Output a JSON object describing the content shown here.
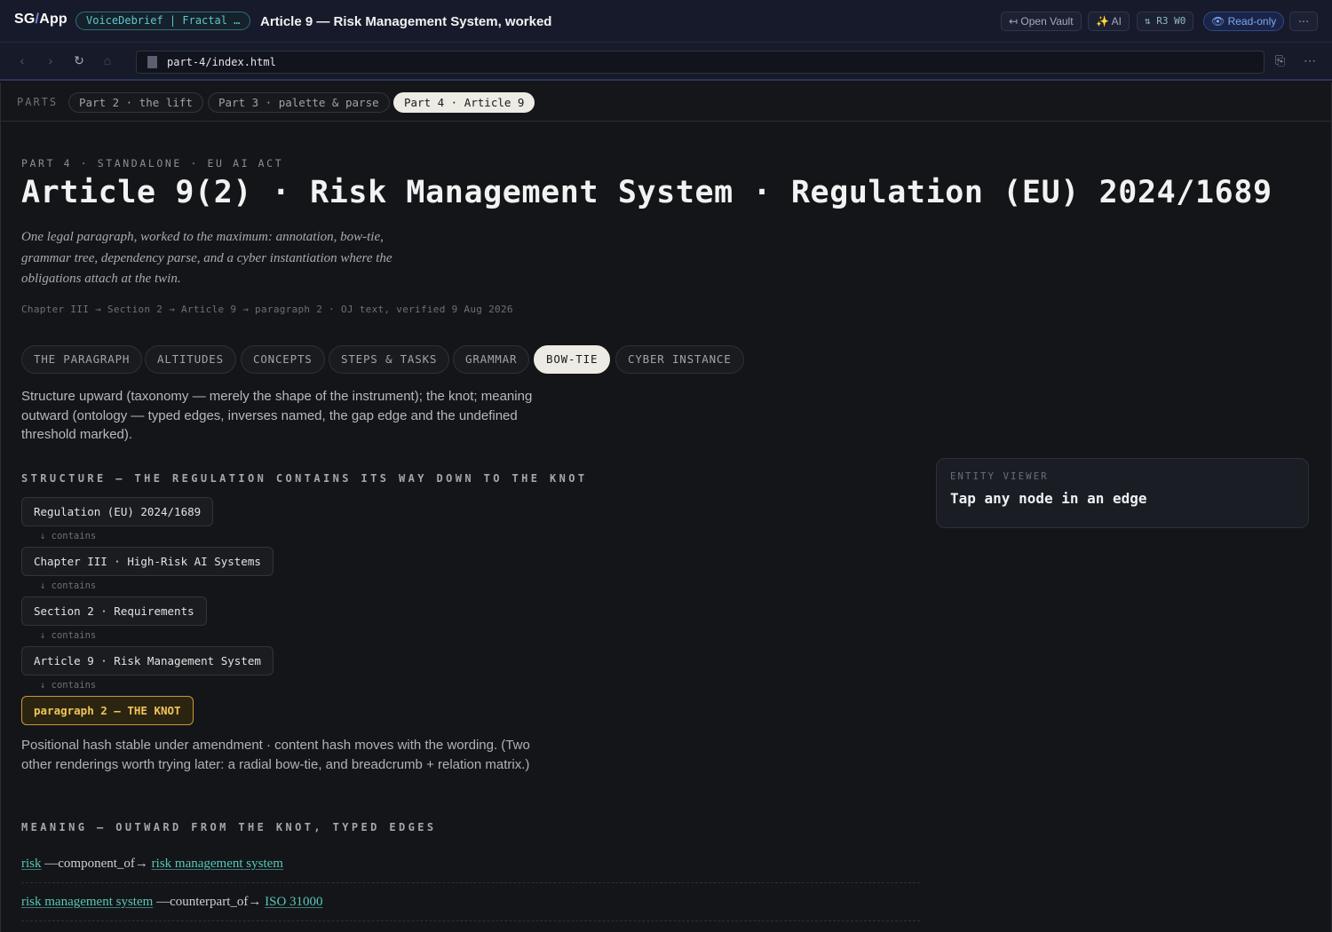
{
  "app": {
    "brand_left": "SG",
    "brand_slash": "/",
    "brand_right": "App",
    "project": "VoiceDebrief | Fractal …",
    "title": "Article 9 — Risk Management System, worked",
    "buttons": {
      "open_vault": "↤ Open Vault",
      "ai": "✨ AI",
      "rw": "⇅ R3 W0",
      "readonly": "👁 Read-only",
      "more": "⋯"
    }
  },
  "nav": {
    "back_icon": "‹",
    "forward_icon": "›",
    "reload_icon": "↻",
    "home_icon": "⌂",
    "url": "part-4/index.html",
    "copy_icon": "⎘",
    "menu_icon": "⋯"
  },
  "parts": {
    "label": "PARTS",
    "items": [
      "Part 2 · the lift",
      "Part 3 · palette & parse",
      "Part 4 · Article 9"
    ],
    "active_index": 2
  },
  "hero": {
    "eyebrow": "PART 4 · STANDALONE · EU AI ACT",
    "title": "Article 9(2) · Risk Management System · Regulation (EU) 2024/1689",
    "lede": "One legal paragraph, worked to the maximum: annotation, bow-tie, grammar tree, dependency parse, and a cyber instantiation where the obligations attach at the twin.",
    "path": "Chapter III → Section 2 → Article 9 → paragraph 2 · OJ text, verified 9 Aug 2026"
  },
  "tabs": {
    "items": [
      "THE PARAGRAPH",
      "ALTITUDES",
      "CONCEPTS",
      "STEPS & TASKS",
      "GRAMMAR",
      "BOW-TIE",
      "CYBER INSTANCE"
    ],
    "active": "BOW-TIE"
  },
  "bowtie": {
    "intro": "Structure upward (taxonomy — merely the shape of the instrument); the knot; meaning outward (ontology — typed edges, inverses named, the gap edge and the undefined threshold marked).",
    "structure_heading": "STRUCTURE — THE REGULATION CONTAINS ITS WAY DOWN TO THE KNOT",
    "chain": [
      "Regulation (EU) 2024/1689",
      "Chapter III · High-Risk AI Systems",
      "Section 2 · Requirements",
      "Article 9 · Risk Management System",
      "paragraph 2 — THE KNOT"
    ],
    "edge_label": "↓ contains",
    "note": "Positional hash stable under amendment · content hash moves with the wording. (Two other renderings worth trying later: a radial bow-tie, and breadcrumb + relation matrix.)",
    "meaning_heading": "MEANING — OUTWARD FROM THE KNOT, TYPED EDGES",
    "edges": [
      {
        "subject": "risk",
        "relation": "—component_of→",
        "object": "risk management system"
      },
      {
        "subject": "risk management system",
        "relation": "—counterpart_of→",
        "object": "ISO 31000"
      }
    ]
  },
  "viewer": {
    "label": "ENTITY VIEWER",
    "value": "Tap any node in an edge"
  }
}
